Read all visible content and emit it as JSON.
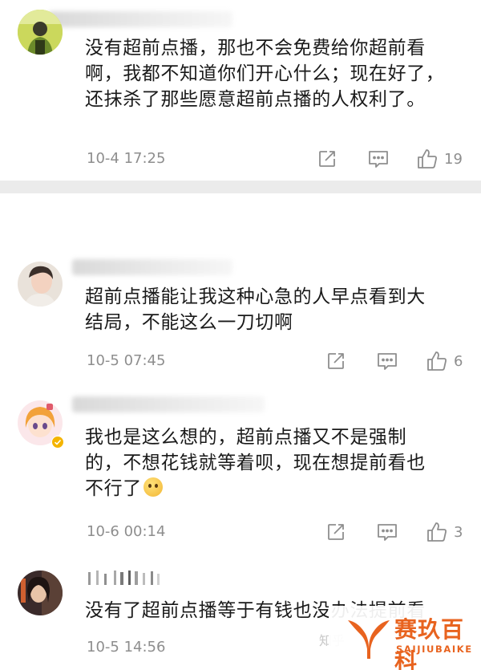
{
  "comments": [
    {
      "lines": [
        "没有超前点播，那也不会免费给你超前看",
        "啊，我都不知道你们开心什么；现在好了，",
        "还抹杀了那些愿意超前点播的人权利了。"
      ],
      "timestamp": "10-4 17:25",
      "likes": "19"
    },
    {
      "lines": [
        "超前点播能让我这种心急的人早点看到大",
        "结局，不能这么一刀切啊"
      ],
      "timestamp": "10-5 07:45",
      "likes": "6"
    },
    {
      "lines": [
        "我也是这么想的，超前点播又不是强制",
        "的，不想花钱就等着呗，现在想提前看也",
        "不行了"
      ],
      "timestamp": "10-6 00:14",
      "likes": "3"
    },
    {
      "lines": [
        "没有了超前点播等于有钱也没办法提前看"
      ],
      "timestamp": "10-5 14:56"
    }
  ],
  "icons": {
    "share": "share-icon",
    "reply": "comment-icon",
    "like": "thumbs-up-icon"
  },
  "watermark": {
    "platform": "知乎",
    "brand_cn": "赛玖百科",
    "brand_en": "SAIJIUBAIKE"
  },
  "colors": {
    "text": "#1a1a1a",
    "meta": "#8e8e8e",
    "divider": "#ebebeb",
    "watermark": "#e8631f"
  }
}
